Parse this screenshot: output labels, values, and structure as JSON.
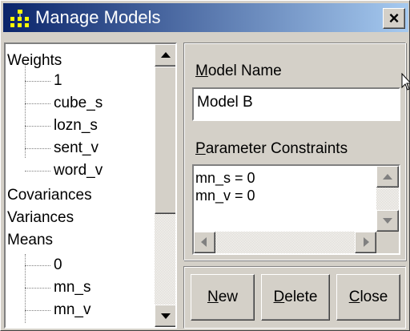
{
  "window": {
    "title": "Manage Models",
    "close_glyph": "×"
  },
  "tree": {
    "items": [
      {
        "label": "Weights",
        "level": 0
      },
      {
        "label": "1",
        "level": 1
      },
      {
        "label": "cube_s",
        "level": 1
      },
      {
        "label": "lozn_s",
        "level": 1
      },
      {
        "label": "sent_v",
        "level": 1
      },
      {
        "label": "word_v",
        "level": 1
      },
      {
        "label": "Covariances",
        "level": 0
      },
      {
        "label": "Variances",
        "level": 0
      },
      {
        "label": "Means",
        "level": 0
      },
      {
        "label": "0",
        "level": 1
      },
      {
        "label": "mn_s",
        "level": 1
      },
      {
        "label": "mn_v",
        "level": 1
      }
    ]
  },
  "model_name": {
    "label_accel": "M",
    "label_rest": "odel Name",
    "value": "Model B"
  },
  "constraints": {
    "label_accel": "P",
    "label_rest": "arameter Constraints",
    "lines": [
      "mn_s = 0",
      "mn_v = 0"
    ]
  },
  "buttons": {
    "new_accel": "N",
    "new_rest": "ew",
    "delete_accel": "D",
    "delete_rest": "elete",
    "close_accel": "C",
    "close_rest": "lose"
  },
  "icons": {
    "app": "network-diagram-icon",
    "close": "close-icon",
    "cursor": "mouse-pointer-icon"
  }
}
